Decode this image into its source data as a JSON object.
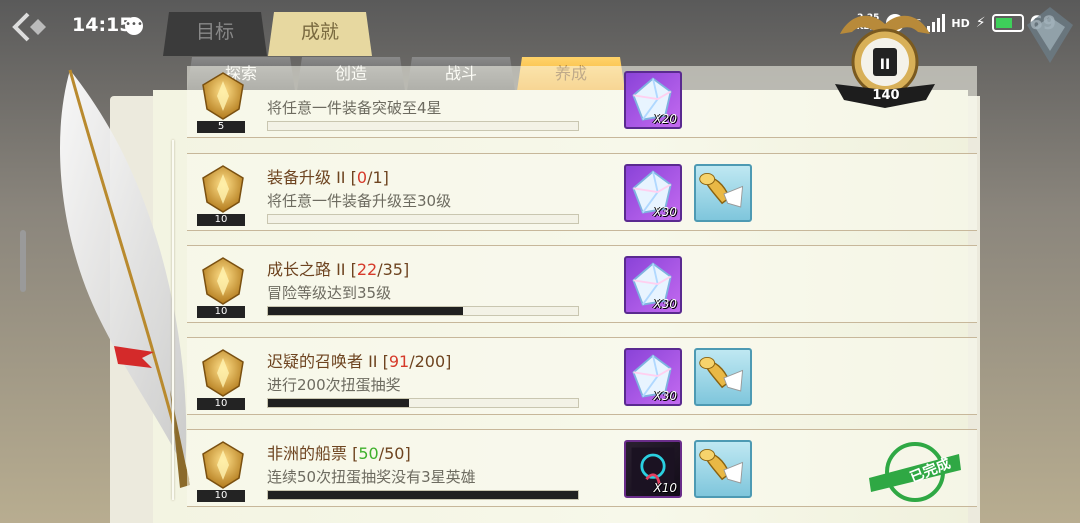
{
  "status": {
    "time": "14:15",
    "net_speed": "2.25",
    "net_unit": "KB/S",
    "network_type": "4G",
    "hd": "HD",
    "battery": "69"
  },
  "top_tabs": [
    {
      "label": "目标"
    },
    {
      "label": "成就"
    }
  ],
  "sub_tabs": [
    {
      "label": "探索"
    },
    {
      "label": "创造"
    },
    {
      "label": "战斗"
    },
    {
      "label": "养成",
      "active": true
    }
  ],
  "rank": {
    "roman": "II",
    "points": "140"
  },
  "achievements": [
    {
      "level": "5",
      "title": "",
      "progress_current": "",
      "progress_total": "",
      "desc": "将任意一件装备突破至4星",
      "progress": 0,
      "rewards": [
        {
          "icon": "crystal-icon",
          "qty": "X20"
        }
      ]
    },
    {
      "level": "10",
      "title": "装备升级 II",
      "progress_current": "0",
      "progress_total": "1",
      "desc": "将任意一件装备升级至30级",
      "progress": 0,
      "rewards": [
        {
          "icon": "crystal-icon",
          "qty": "X30"
        },
        {
          "icon": "horn-icon",
          "qty": ""
        }
      ]
    },
    {
      "level": "10",
      "title": "成长之路 II",
      "progress_current": "22",
      "progress_total": "35",
      "desc": "冒险等级达到35级",
      "progress": 0.63,
      "rewards": [
        {
          "icon": "crystal-icon",
          "qty": "X30"
        }
      ]
    },
    {
      "level": "10",
      "title": "迟疑的召唤者 II",
      "progress_current": "91",
      "progress_total": "200",
      "desc": "进行200次扭蛋抽奖",
      "progress": 0.455,
      "rewards": [
        {
          "icon": "crystal-icon",
          "qty": "X30"
        },
        {
          "icon": "horn-icon",
          "qty": ""
        }
      ]
    },
    {
      "level": "10",
      "title": "非洲的船票",
      "progress_current": "50",
      "progress_total": "50",
      "desc": "连续50次扭蛋抽奖没有3星英雄",
      "progress": 1,
      "rewards": [
        {
          "icon": "card-icon",
          "qty": "X10"
        },
        {
          "icon": "horn-icon",
          "qty": ""
        }
      ],
      "completed_label": "已完成"
    }
  ]
}
